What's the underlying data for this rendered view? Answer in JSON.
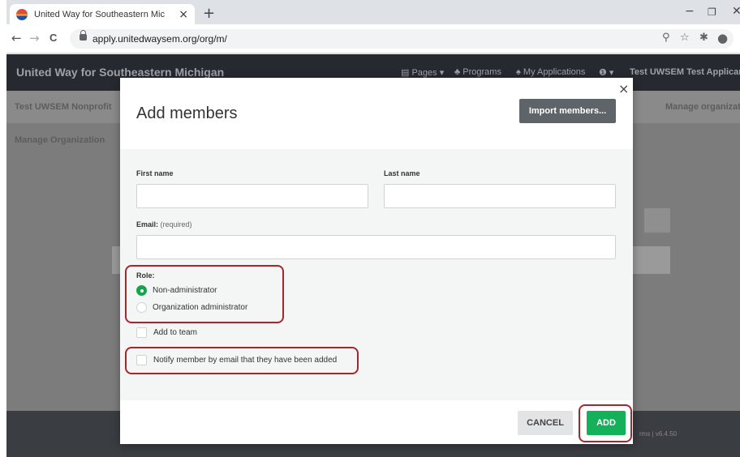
{
  "browser": {
    "tab_title": "United Way for Southeastern Mic",
    "tab_close": "×",
    "new_tab": "+",
    "url": "apply.unitedwaysem.org/org/m/",
    "window_controls": {
      "minimize": "−",
      "restore": "❐",
      "close": "✕"
    },
    "nav": {
      "back": "←",
      "forward": "→",
      "reload": "C"
    },
    "omnibox_icons": {
      "zoom": "⚲",
      "star": "☆",
      "extensions": "✱",
      "profile": "●"
    }
  },
  "site": {
    "title": "United Way for Southeastern Michigan",
    "nav": {
      "pages": "▤ Pages ▾",
      "programs": "♣ Programs",
      "applications": "♠ My Applications",
      "help": "❶ ▾",
      "user": "Test UWSEM Test Applicant"
    },
    "org_name": "Test UWSEM Nonprofit",
    "manage_org_link": "Manage organizatio",
    "breadcrumb": "Manage Organization",
    "footer_version": "rms | v6.4.50"
  },
  "modal": {
    "close_label": "×",
    "title": "Add members",
    "import_button": "Import members...",
    "fields": {
      "first_name": {
        "label": "First name",
        "value": ""
      },
      "last_name": {
        "label": "Last name",
        "value": ""
      },
      "email": {
        "label": "Email:",
        "hint": "(required)",
        "value": ""
      }
    },
    "role": {
      "label": "Role:",
      "options": [
        {
          "label": "Non-administrator",
          "selected": true
        },
        {
          "label": "Organization administrator",
          "selected": false
        }
      ]
    },
    "checkboxes": {
      "add_to_team": {
        "label": "Add to team",
        "checked": false
      },
      "notify_member": {
        "label": "Notify member by email that they have been added",
        "checked": false
      }
    },
    "cancel_button": "CANCEL",
    "add_button": "ADD"
  },
  "colors": {
    "accent_green": "#15b05a",
    "highlight_red": "#a8262b",
    "header_dark": "#262a30",
    "import_button_gray": "#5f6468"
  }
}
